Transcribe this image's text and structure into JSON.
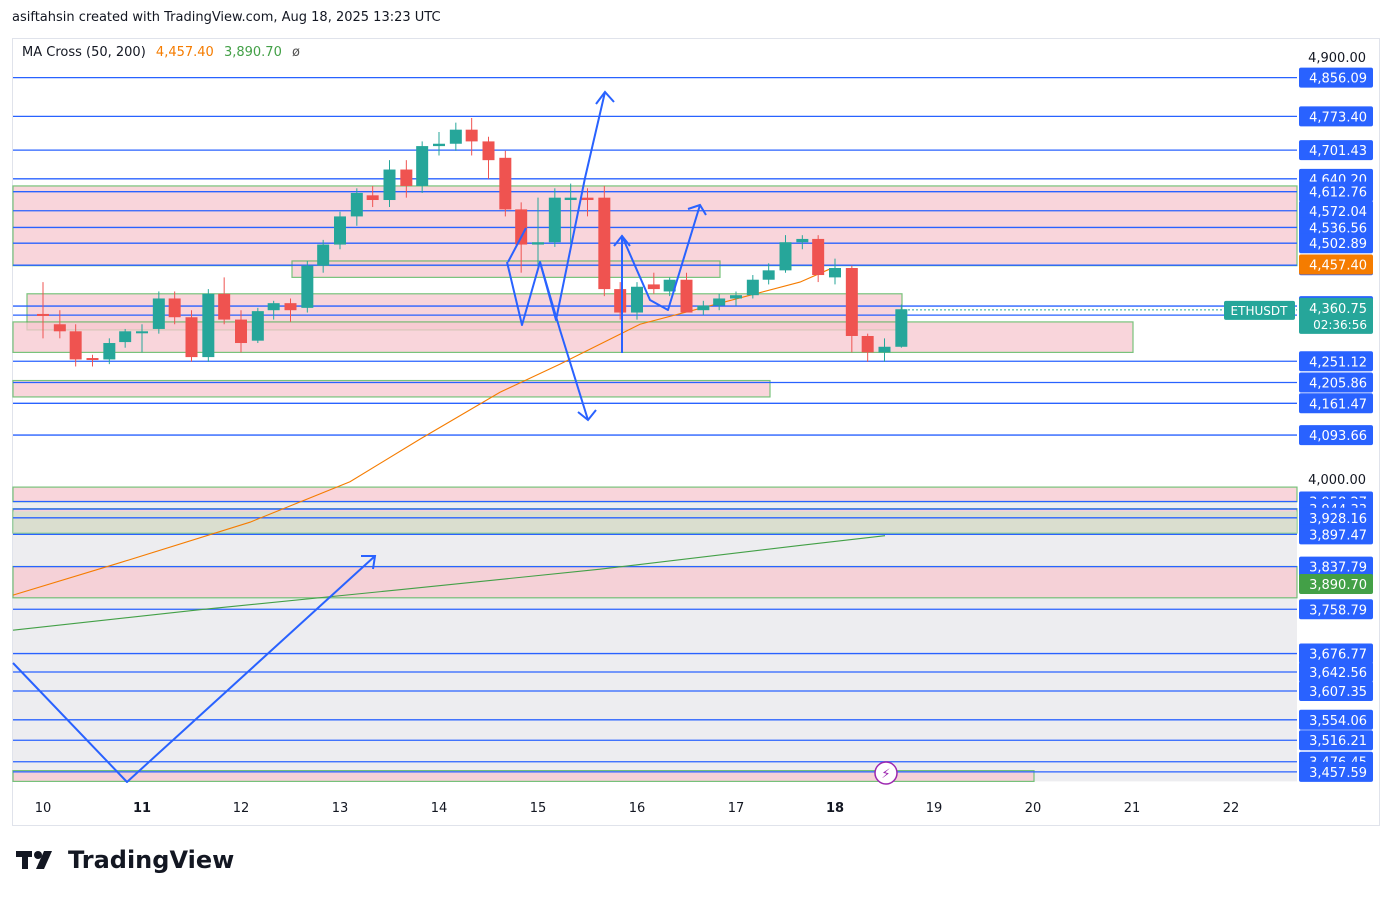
{
  "header": {
    "attribution": "asiftahsin created with TradingView.com, Aug 18, 2025 13:23 UTC"
  },
  "indicator": {
    "name": "MA Cross (50, 200)",
    "ma50": "4,457.40",
    "ma200": "3,890.70",
    "symbol": "ø"
  },
  "footer": {
    "brand": "TradingView"
  },
  "colors": {
    "up": "#26a69a",
    "down": "#ef5350",
    "level": "#2962ff",
    "zone": "#f8c8cf",
    "zone_border": "#4caf50",
    "ma50": "#f57c00",
    "ma200": "#43a047",
    "grey_zone": "#e8e8ec"
  },
  "chart_data": {
    "type": "candlestick",
    "symbol": "ETHUSDT",
    "countdown": "02:36:56",
    "last_price": "4,360.75",
    "x_ticks": [
      "10",
      "11",
      "12",
      "13",
      "14",
      "15",
      "16",
      "17",
      "18",
      "19",
      "20",
      "21",
      "22"
    ],
    "bold_x_ticks": [
      "11",
      "18"
    ],
    "y_range": [
      3440,
      4950
    ],
    "axis_ticks": [
      "4,900.00",
      "4,000.00"
    ],
    "levels": [
      "4,856.09",
      "4,773.40",
      "4,701.43",
      "4,640.20",
      "4,612.76",
      "4,572.04",
      "4,536.56",
      "4,502.89",
      "4,455.98",
      "4,368.79",
      "4,349.46",
      "4,251.12",
      "4,205.86",
      "4,161.47",
      "4,093.66",
      "3,958.27",
      "3,944.33",
      "3,928.16",
      "3,897.47",
      "3,837.79",
      "3,758.79",
      "3,676.77",
      "3,642.56",
      "3,607.35",
      "3,554.06",
      "3,516.21",
      "3,476.45",
      "3,457.59"
    ],
    "ma50_label": "4,457.40",
    "ma200_label": "3,890.70",
    "candles": [
      {
        "d": 10.0,
        "o": 4352,
        "h": 4420,
        "l": 4300,
        "c": 4348
      },
      {
        "d": 10.17,
        "o": 4330,
        "h": 4360,
        "l": 4300,
        "c": 4315
      },
      {
        "d": 10.33,
        "o": 4315,
        "h": 4330,
        "l": 4240,
        "c": 4255
      },
      {
        "d": 10.5,
        "o": 4258,
        "h": 4265,
        "l": 4240,
        "c": 4255
      },
      {
        "d": 10.67,
        "o": 4255,
        "h": 4300,
        "l": 4245,
        "c": 4290
      },
      {
        "d": 10.83,
        "o": 4292,
        "h": 4320,
        "l": 4280,
        "c": 4315
      },
      {
        "d": 11.0,
        "o": 4315,
        "h": 4330,
        "l": 4270,
        "c": 4315
      },
      {
        "d": 11.17,
        "o": 4320,
        "h": 4400,
        "l": 4310,
        "c": 4385
      },
      {
        "d": 11.33,
        "o": 4385,
        "h": 4400,
        "l": 4330,
        "c": 4345
      },
      {
        "d": 11.5,
        "o": 4345,
        "h": 4360,
        "l": 4250,
        "c": 4260
      },
      {
        "d": 11.67,
        "o": 4260,
        "h": 4405,
        "l": 4250,
        "c": 4395
      },
      {
        "d": 11.83,
        "o": 4395,
        "h": 4430,
        "l": 4330,
        "c": 4340
      },
      {
        "d": 12.0,
        "o": 4340,
        "h": 4360,
        "l": 4270,
        "c": 4290
      },
      {
        "d": 12.17,
        "o": 4295,
        "h": 4365,
        "l": 4290,
        "c": 4358
      },
      {
        "d": 12.33,
        "o": 4360,
        "h": 4380,
        "l": 4340,
        "c": 4375
      },
      {
        "d": 12.5,
        "o": 4375,
        "h": 4385,
        "l": 4335,
        "c": 4360
      },
      {
        "d": 12.67,
        "o": 4365,
        "h": 4465,
        "l": 4355,
        "c": 4455
      },
      {
        "d": 12.83,
        "o": 4455,
        "h": 4510,
        "l": 4440,
        "c": 4500
      },
      {
        "d": 13.0,
        "o": 4500,
        "h": 4570,
        "l": 4490,
        "c": 4560
      },
      {
        "d": 13.17,
        "o": 4560,
        "h": 4620,
        "l": 4540,
        "c": 4610
      },
      {
        "d": 13.33,
        "o": 4605,
        "h": 4625,
        "l": 4580,
        "c": 4595
      },
      {
        "d": 13.5,
        "o": 4595,
        "h": 4680,
        "l": 4580,
        "c": 4660
      },
      {
        "d": 13.67,
        "o": 4660,
        "h": 4680,
        "l": 4600,
        "c": 4625
      },
      {
        "d": 13.83,
        "o": 4625,
        "h": 4720,
        "l": 4610,
        "c": 4710
      },
      {
        "d": 14.0,
        "o": 4710,
        "h": 4740,
        "l": 4690,
        "c": 4715
      },
      {
        "d": 14.17,
        "o": 4715,
        "h": 4760,
        "l": 4700,
        "c": 4745
      },
      {
        "d": 14.33,
        "o": 4745,
        "h": 4770,
        "l": 4690,
        "c": 4720
      },
      {
        "d": 14.5,
        "o": 4720,
        "h": 4730,
        "l": 4640,
        "c": 4680
      },
      {
        "d": 14.67,
        "o": 4685,
        "h": 4700,
        "l": 4560,
        "c": 4575
      },
      {
        "d": 14.83,
        "o": 4575,
        "h": 4590,
        "l": 4440,
        "c": 4500
      },
      {
        "d": 15.0,
        "o": 4500,
        "h": 4600,
        "l": 4450,
        "c": 4505
      },
      {
        "d": 15.17,
        "o": 4505,
        "h": 4620,
        "l": 4495,
        "c": 4600
      },
      {
        "d": 15.33,
        "o": 4595,
        "h": 4630,
        "l": 4500,
        "c": 4600
      },
      {
        "d": 15.5,
        "o": 4600,
        "h": 4620,
        "l": 4560,
        "c": 4595
      },
      {
        "d": 15.67,
        "o": 4600,
        "h": 4625,
        "l": 4390,
        "c": 4405
      },
      {
        "d": 15.83,
        "o": 4405,
        "h": 4420,
        "l": 4340,
        "c": 4355
      },
      {
        "d": 16.0,
        "o": 4355,
        "h": 4420,
        "l": 4340,
        "c": 4410
      },
      {
        "d": 16.17,
        "o": 4415,
        "h": 4440,
        "l": 4395,
        "c": 4405
      },
      {
        "d": 16.33,
        "o": 4400,
        "h": 4430,
        "l": 4390,
        "c": 4425
      },
      {
        "d": 16.5,
        "o": 4425,
        "h": 4440,
        "l": 4390,
        "c": 4355
      },
      {
        "d": 16.67,
        "o": 4360,
        "h": 4380,
        "l": 4350,
        "c": 4370
      },
      {
        "d": 16.83,
        "o": 4370,
        "h": 4395,
        "l": 4360,
        "c": 4385
      },
      {
        "d": 17.0,
        "o": 4385,
        "h": 4400,
        "l": 4370,
        "c": 4392
      },
      {
        "d": 17.17,
        "o": 4392,
        "h": 4435,
        "l": 4385,
        "c": 4425
      },
      {
        "d": 17.33,
        "o": 4425,
        "h": 4460,
        "l": 4415,
        "c": 4445
      },
      {
        "d": 17.5,
        "o": 4445,
        "h": 4520,
        "l": 4440,
        "c": 4505
      },
      {
        "d": 17.67,
        "o": 4505,
        "h": 4520,
        "l": 4490,
        "c": 4512
      },
      {
        "d": 17.83,
        "o": 4512,
        "h": 4520,
        "l": 4420,
        "c": 4435
      },
      {
        "d": 18.0,
        "o": 4430,
        "h": 4470,
        "l": 4415,
        "c": 4450
      },
      {
        "d": 18.17,
        "o": 4450,
        "h": 4455,
        "l": 4270,
        "c": 4305
      },
      {
        "d": 18.33,
        "o": 4305,
        "h": 4310,
        "l": 4250,
        "c": 4270
      },
      {
        "d": 18.5,
        "o": 4270,
        "h": 4300,
        "l": 4250,
        "c": 4282
      },
      {
        "d": 18.67,
        "o": 4282,
        "h": 4372,
        "l": 4280,
        "c": 4362
      }
    ]
  }
}
